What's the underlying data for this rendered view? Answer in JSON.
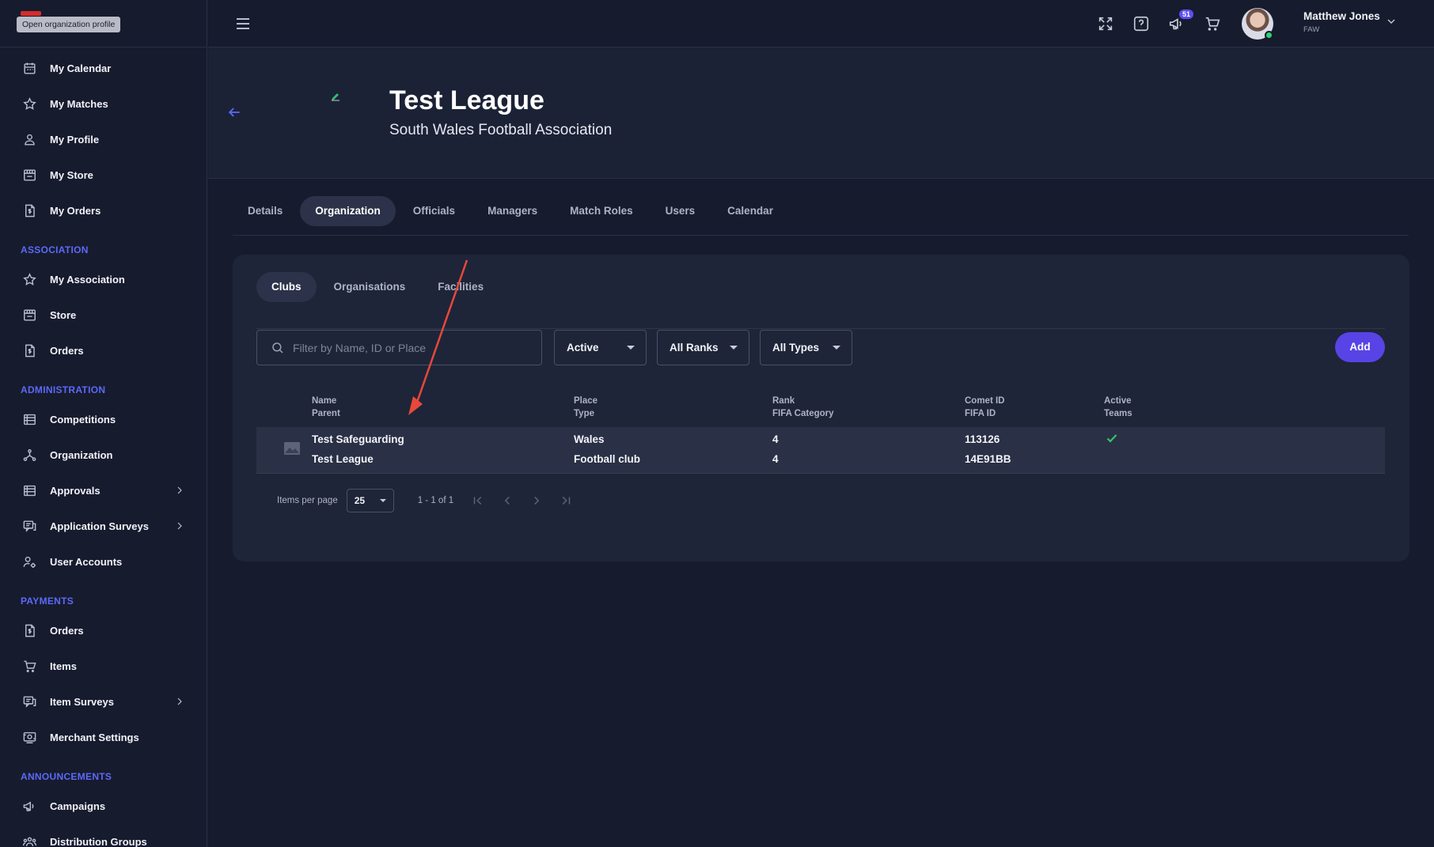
{
  "sidebar": {
    "tooltip": "Open organization profile",
    "personal": [
      {
        "label": "My Calendar",
        "icon": "calendar-icon"
      },
      {
        "label": "My Matches",
        "icon": "star-icon"
      },
      {
        "label": "My Profile",
        "icon": "person-icon"
      },
      {
        "label": "My Store",
        "icon": "store-icon"
      },
      {
        "label": "My Orders",
        "icon": "receipt-icon"
      }
    ],
    "sections": [
      {
        "title": "ASSOCIATION",
        "items": [
          {
            "label": "My Association",
            "icon": "star-icon"
          },
          {
            "label": "Store",
            "icon": "store-icon"
          },
          {
            "label": "Orders",
            "icon": "receipt-icon"
          }
        ]
      },
      {
        "title": "ADMINISTRATION",
        "items": [
          {
            "label": "Competitions",
            "icon": "list-icon"
          },
          {
            "label": "Organization",
            "icon": "hierarchy-icon"
          },
          {
            "label": "Approvals",
            "icon": "list-icon",
            "chevron": true
          },
          {
            "label": "Application Surveys",
            "icon": "survey-icon",
            "chevron": true
          },
          {
            "label": "User Accounts",
            "icon": "user-accounts-icon"
          }
        ]
      },
      {
        "title": "PAYMENTS",
        "items": [
          {
            "label": "Orders",
            "icon": "receipt-icon"
          },
          {
            "label": "Items",
            "icon": "cart-icon"
          },
          {
            "label": "Item Surveys",
            "icon": "survey-icon",
            "chevron": true
          },
          {
            "label": "Merchant Settings",
            "icon": "merchant-icon"
          }
        ]
      },
      {
        "title": "ANNOUNCEMENTS",
        "items": [
          {
            "label": "Campaigns",
            "icon": "megaphone-icon"
          },
          {
            "label": "Distribution Groups",
            "icon": "group-icon"
          }
        ]
      }
    ]
  },
  "topbar": {
    "notification_count": "51",
    "user_name": "Matthew Jones",
    "user_org": "FAW"
  },
  "header": {
    "title": "Test League",
    "subtitle": "South Wales Football Association"
  },
  "main_tabs": [
    "Details",
    "Organization",
    "Officials",
    "Managers",
    "Match Roles",
    "Users",
    "Calendar"
  ],
  "main_tab_active": "Organization",
  "sub_tabs": [
    "Clubs",
    "Organisations",
    "Facilities"
  ],
  "sub_tab_active": "Clubs",
  "filters": {
    "search_placeholder": "Filter by Name, ID or Place",
    "status": "Active",
    "rank": "All Ranks",
    "type": "All Types",
    "add_label": "Add"
  },
  "table": {
    "headers": [
      {
        "top": "Name",
        "bottom": "Parent"
      },
      {
        "top": "Place",
        "bottom": "Type"
      },
      {
        "top": "Rank",
        "bottom": "FIFA Category"
      },
      {
        "top": "Comet ID",
        "bottom": "FIFA ID"
      },
      {
        "top": "Active",
        "bottom": "Teams"
      }
    ],
    "rows": [
      {
        "name": "Test Safeguarding",
        "parent": "Test League",
        "place": "Wales",
        "type": "Football club",
        "rank": "4",
        "fifa_category": "4",
        "comet_id": "113126",
        "fifa_id": "14E91BB",
        "active": true
      }
    ]
  },
  "pagination": {
    "items_per_page_label": "Items per page",
    "page_size": "25",
    "range": "1 - 1 of 1"
  },
  "colors": {
    "accent": "#5844e6",
    "section_title": "#5b6af7",
    "annotation_arrow": "#e8483a",
    "active_check": "#32c36c"
  }
}
